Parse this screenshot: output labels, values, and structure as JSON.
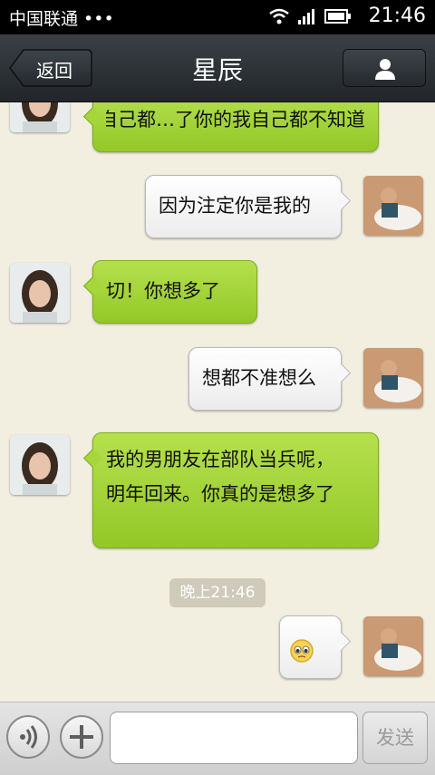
{
  "status_bar": {
    "carrier": "中国联通 •••",
    "time": "21:46"
  },
  "header": {
    "back_label": "返回",
    "title": "星辰"
  },
  "messages": [
    {
      "side": "left",
      "text": "我只…自己都…了你的我自己都不知道"
    },
    {
      "side": "right",
      "text": "因为注定你是我的"
    },
    {
      "side": "left",
      "text": "切！你想多了"
    },
    {
      "side": "right",
      "text": "想都不准想么"
    },
    {
      "side": "left",
      "text": "我的男朋友在部队当兵呢，明年回来。你真的是想多了"
    },
    {
      "side": "right",
      "text": "",
      "emoji": "pleading-face"
    }
  ],
  "timestamp": "晚上21:46",
  "input_bar": {
    "placeholder": "",
    "send_label": "发送"
  },
  "colors": {
    "accent_green": "#9fd236",
    "header_bg": "#2e3338",
    "chat_bg": "#f2eee0"
  }
}
